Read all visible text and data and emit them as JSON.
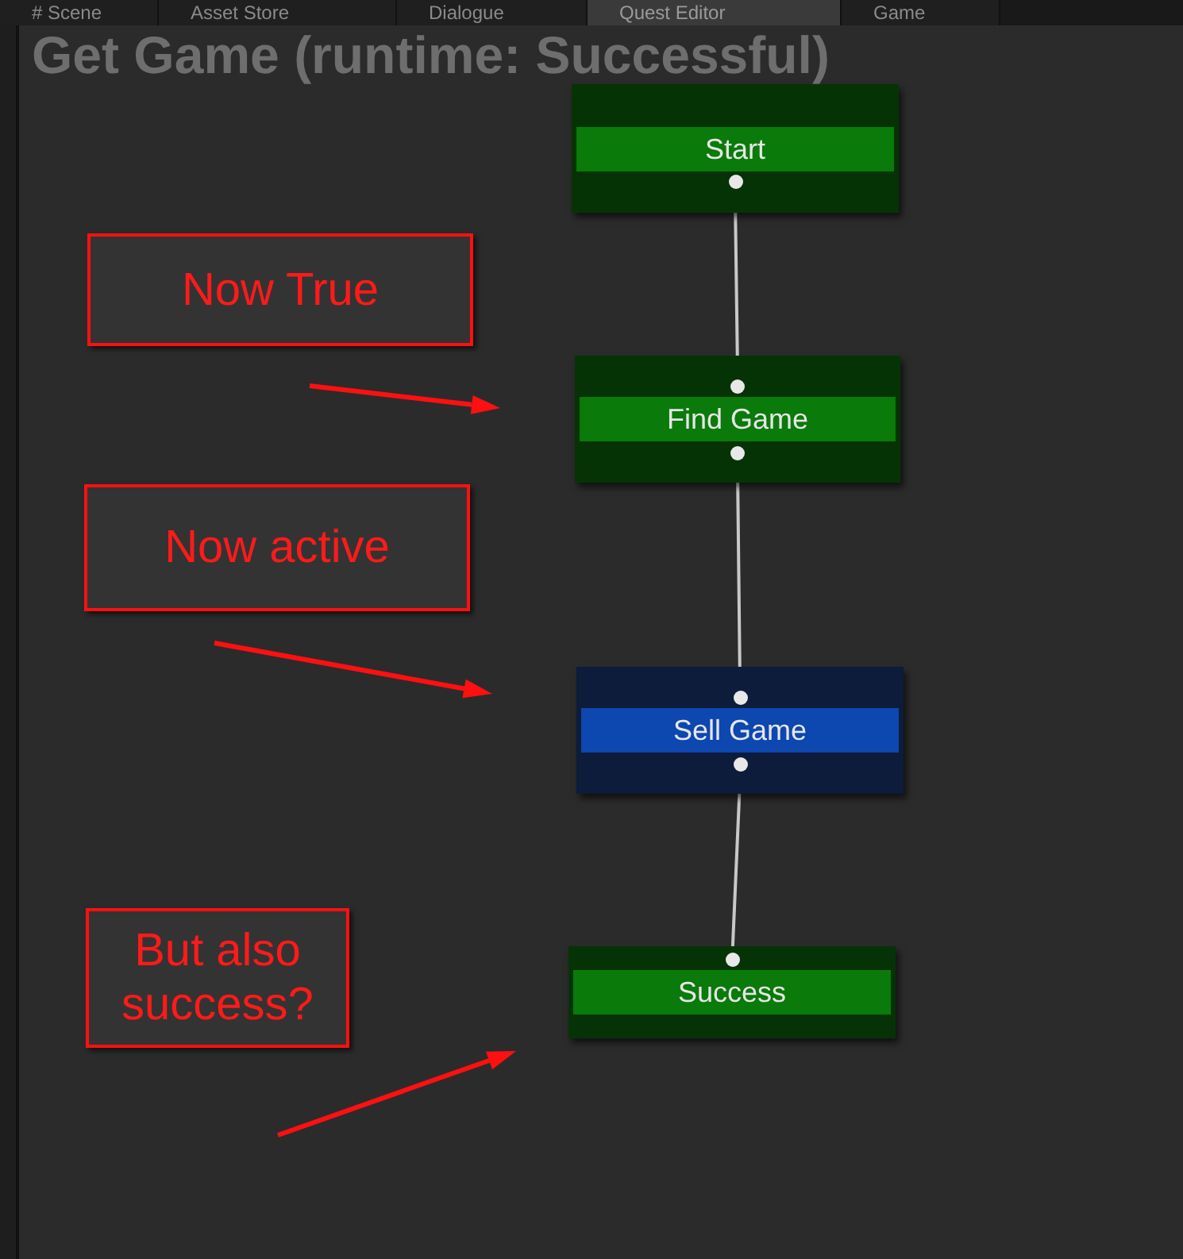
{
  "tabs": [
    {
      "label": "# Scene",
      "selected": false
    },
    {
      "label": "Asset Store",
      "selected": false
    },
    {
      "label": "Dialogue",
      "selected": false
    },
    {
      "label": "Quest Editor",
      "selected": true
    },
    {
      "label": "Game",
      "selected": false
    }
  ],
  "graph_title": "Get Game (runtime: Successful)",
  "nodes": [
    {
      "label": "Start",
      "active": false,
      "has_input": false,
      "has_output": true
    },
    {
      "label": "Find Game",
      "active": false,
      "has_input": true,
      "has_output": true
    },
    {
      "label": "Sell Game",
      "active": true,
      "has_input": true,
      "has_output": true
    },
    {
      "label": "Success",
      "active": false,
      "has_input": true,
      "has_output": false
    }
  ],
  "annotations": [
    "Now True",
    "Now active",
    "But also success?"
  ]
}
